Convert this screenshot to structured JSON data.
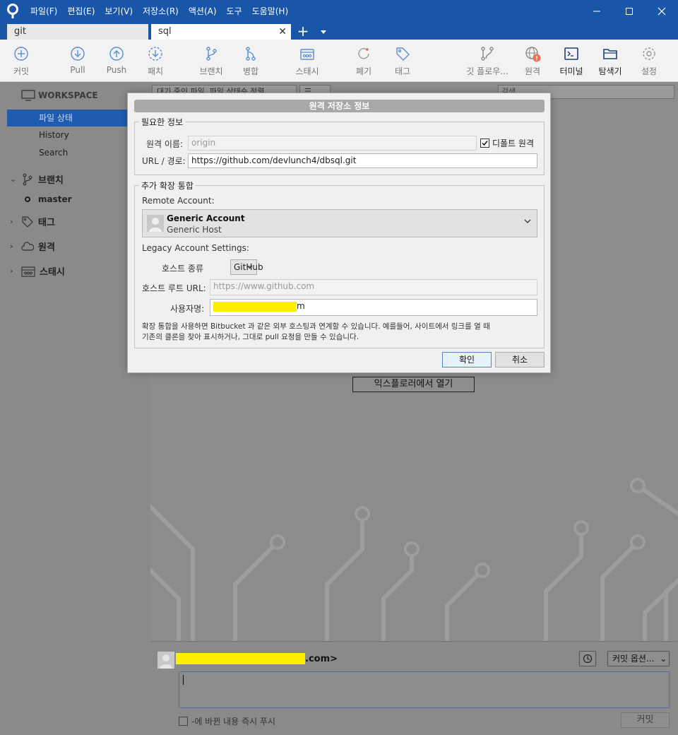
{
  "menu": [
    "파일(F)",
    "편집(E)",
    "보기(V)",
    "저장소(R)",
    "액션(A)",
    "도구",
    "도움말(H)"
  ],
  "tabs": [
    {
      "label": "git",
      "active": false
    },
    {
      "label": "sql",
      "active": true
    }
  ],
  "toolbar": {
    "commit": "커밋",
    "pull": "Pull",
    "push": "Push",
    "patch": "패치",
    "branch": "브랜치",
    "merge": "병합",
    "stash": "스태시",
    "discard": "폐기",
    "tag": "태그",
    "git_flow": "깃 플로우...",
    "remote": "원격",
    "terminal": "터미널",
    "explorer": "탐색기",
    "settings": "설정"
  },
  "sidebar": {
    "workspace": "WORKSPACE",
    "items": [
      "파일 상태",
      "History",
      "Search"
    ],
    "branches": "브랜치",
    "branch_master": "master",
    "tags": "태그",
    "remotes": "원격",
    "stashes": "스태시"
  },
  "filter": {
    "status_select": "대기 중인 파일, 파일 상태순 정렬",
    "view_select": "☰",
    "search_placeholder": "검색"
  },
  "main": {
    "open_explorer": "익스플로러에서 열기"
  },
  "commit": {
    "author_suffix": ".com>",
    "options": "커밋 옵션...",
    "push_label": "-에 바뀐 내용 즉시 푸시",
    "commit_button": "커밋"
  },
  "dialog": {
    "title": "원격 저장소 정보",
    "required_group": "필요한 정보",
    "remote_name_label": "원격 이름:",
    "remote_name_value": "origin",
    "default_remote": "디폴트 원격",
    "url_label": "URL / 경로:",
    "url_value": "https://github.com/devlunch4/dbsql.git",
    "integration_group": "추가 확장 통합",
    "remote_account_label": "Remote Account:",
    "account_name": "Generic Account",
    "account_host": "Generic Host",
    "legacy_label": "Legacy Account Settings:",
    "host_type_label": "호스트 종류",
    "host_type_value": "GitHub",
    "host_root_label": "호스트 루트 URL:",
    "host_root_value": "https://www.github.com",
    "username_label": "사용자명:",
    "username_suffix": "m",
    "note_line1": "확장 통합을 사용하면 Bitbucket 과 같은 외부 호스팅과 연계할 수 있습니다. 예를들어, 사이트에서 링크를 열 때",
    "note_line2": "기존의 클론을 찾아 표시하거나, 그대로 pull 요청을 만들 수 있습니다.",
    "ok": "확인",
    "cancel": "취소"
  }
}
